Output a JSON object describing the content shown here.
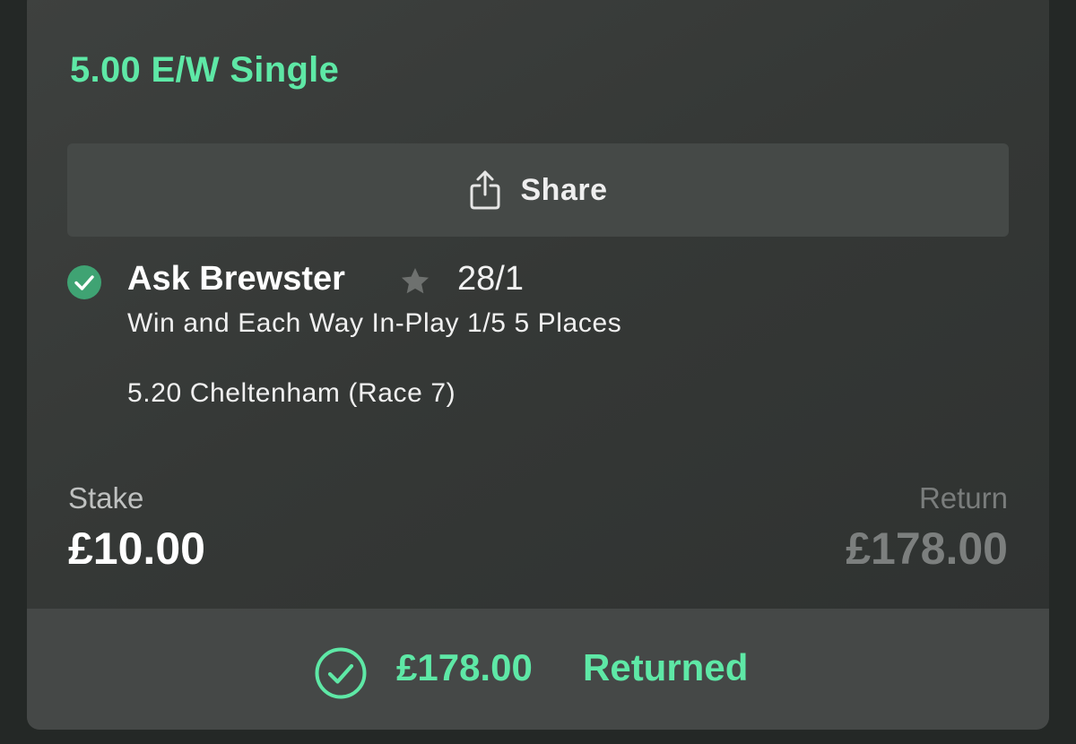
{
  "bet": {
    "title": "5.00 E/W Single"
  },
  "share": {
    "label": "Share",
    "icon": "share-icon"
  },
  "selection": {
    "status_icon": "check-circle-icon",
    "name": "Ask Brewster",
    "favourite_icon": "star-icon",
    "odds": "28/1",
    "market": "Win and Each Way In-Play 1/5 5 Places",
    "event": "5.20 Cheltenham (Race 7)"
  },
  "stake": {
    "label": "Stake",
    "value": "£10.00"
  },
  "return": {
    "label": "Return",
    "value": "£178.00"
  },
  "footer": {
    "icon": "check-circle-outline-icon",
    "amount": "£178.00",
    "status": "Returned"
  },
  "colors": {
    "accent": "#5ee8a6",
    "check_fill": "#3fa373",
    "background": "#242826",
    "card": "#383b39"
  }
}
